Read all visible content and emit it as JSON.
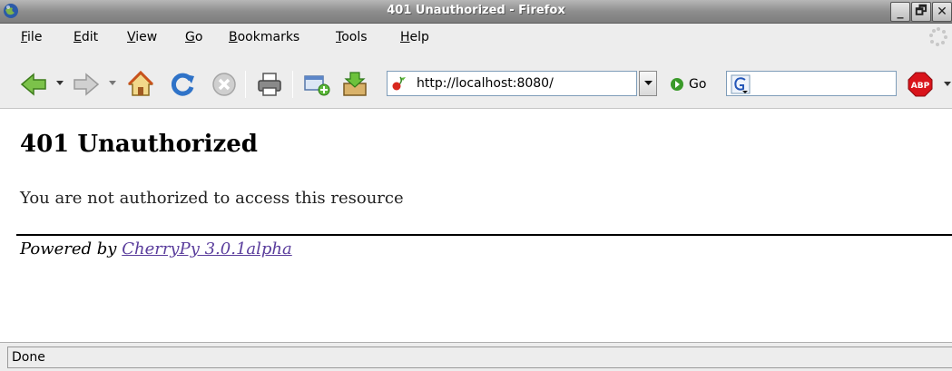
{
  "window": {
    "title": "401 Unauthorized - Firefox",
    "buttons": {
      "minimize": "_",
      "maximize": "🗗",
      "close": "✕"
    }
  },
  "menu": {
    "items": [
      {
        "label": "File",
        "accel": "F",
        "rest": "ile"
      },
      {
        "label": "Edit",
        "accel": "E",
        "rest": "dit"
      },
      {
        "label": "View",
        "accel": "V",
        "rest": "iew"
      },
      {
        "label": "Go",
        "accel": "G",
        "rest": "o"
      },
      {
        "label": "Bookmarks",
        "accel": "B",
        "rest": "ookmarks"
      },
      {
        "label": "Tools",
        "accel": "T",
        "rest": "ools"
      },
      {
        "label": "Help",
        "accel": "H",
        "rest": "elp"
      }
    ]
  },
  "toolbar": {
    "icons": [
      "back-icon",
      "forward-icon",
      "home-icon",
      "reload-icon",
      "stop-icon",
      "print-icon",
      "new-window-icon",
      "download-icon"
    ],
    "url": "http://localhost:8080/",
    "go_label": "Go",
    "search_value": "",
    "adblock_label": "ABP"
  },
  "page": {
    "heading": "401 Unauthorized",
    "message": "You are not authorized to access this resource",
    "powered_prefix": "Powered by ",
    "powered_link": "CherryPy 3.0.1alpha"
  },
  "status": {
    "text": "Done"
  },
  "colors": {
    "link": "#5a3d9c",
    "go_green": "#3a9a2a",
    "abp_red": "#d9141b"
  }
}
